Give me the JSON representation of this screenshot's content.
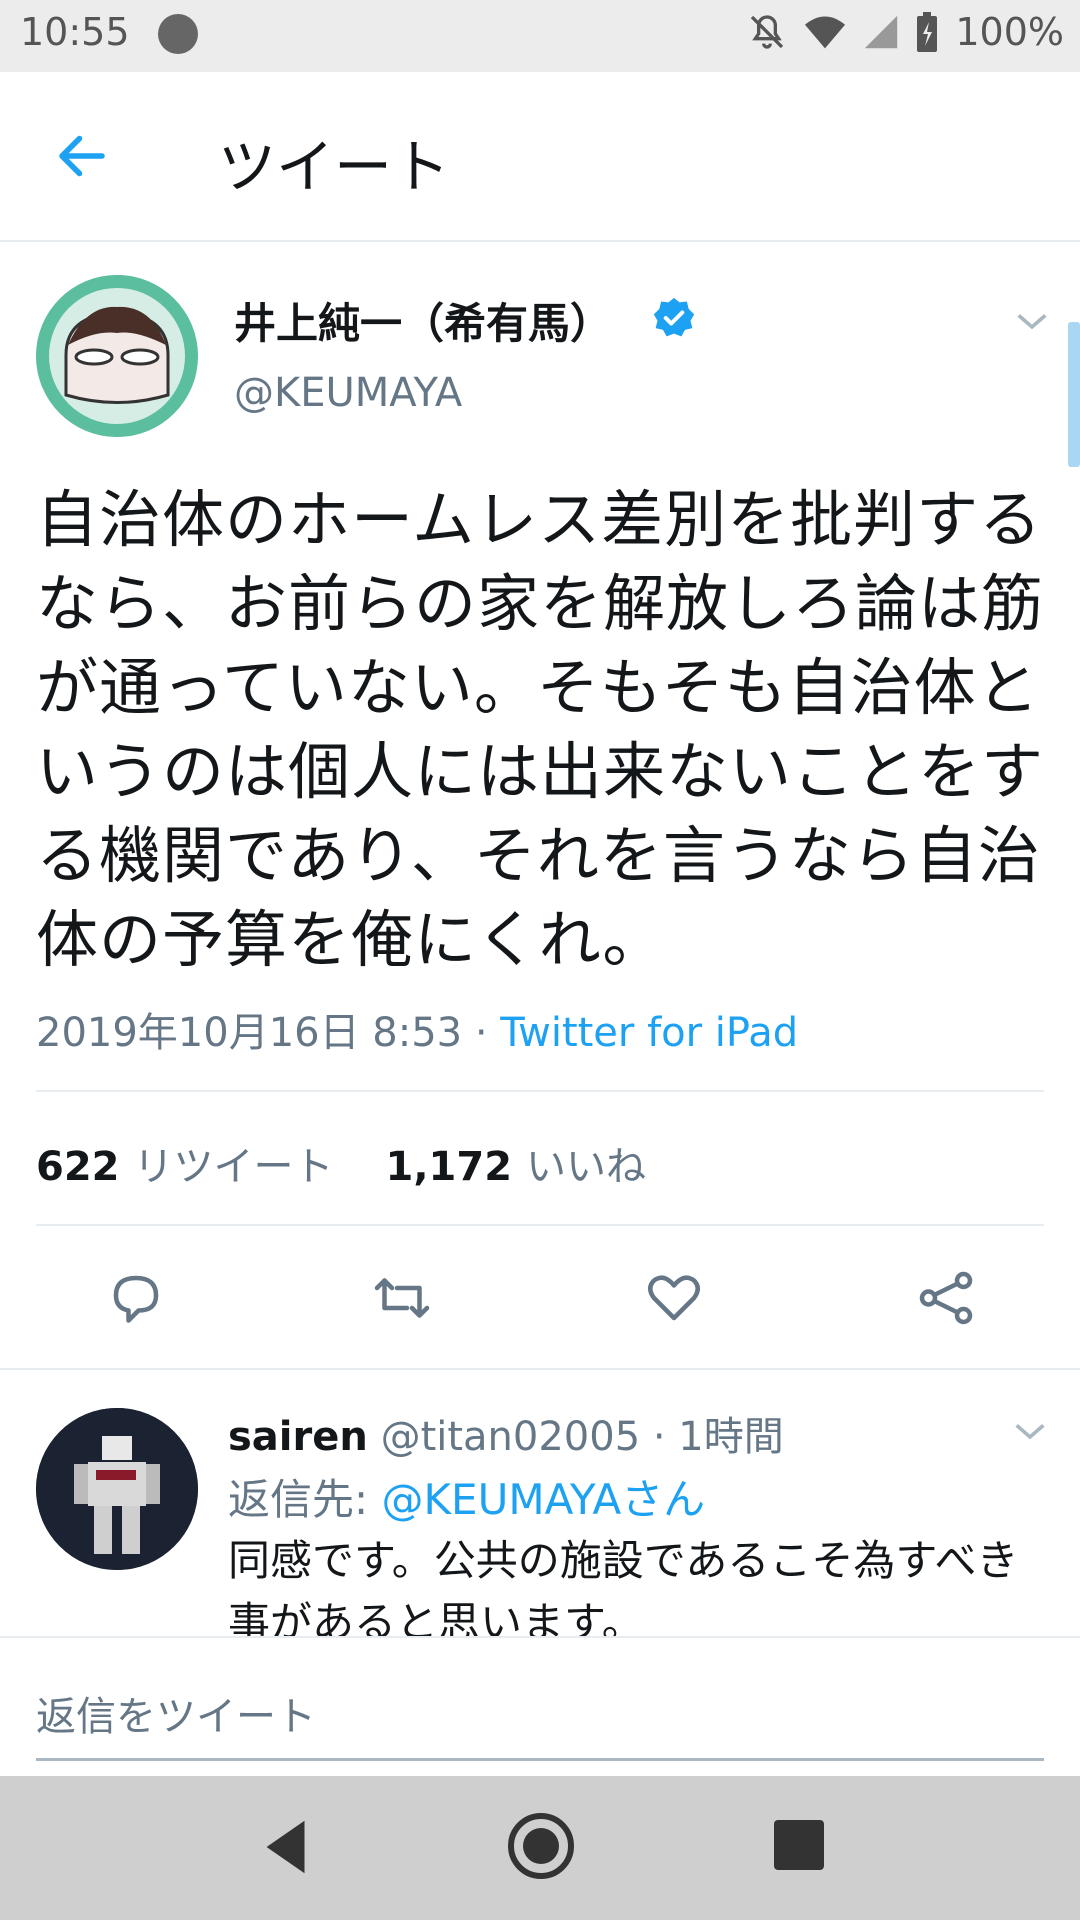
{
  "status_bar": {
    "time": "10:55",
    "battery": "100%",
    "icons": [
      "app-icon",
      "mute-icon",
      "wifi-icon",
      "signal-icon",
      "battery-icon"
    ]
  },
  "app_bar": {
    "title": "ツイート",
    "back_icon": "arrow-left-icon"
  },
  "tweet": {
    "author_name": "井上純一（希有馬）",
    "handle": "@KEUMAYA",
    "text": "自治体のホームレス差別を批判するなら、お前らの家を解放しろ論は筋が通っていない。そもそも自治体というのは個人には出来ないことをする機関であり、それを言うなら自治体の予算を俺にくれ。",
    "timestamp": "2019年10月16日 8:53",
    "separator": " · ",
    "source": "Twitter for iPad",
    "retweet_count": "622",
    "retweet_label": "リツイート",
    "like_count": "1,172",
    "like_label": "いいね",
    "actions": [
      "reply-icon",
      "retweet-icon",
      "like-icon",
      "share-icon"
    ]
  },
  "reply": {
    "name": "sairen",
    "handle": "@titan02005",
    "time": " · 1時間",
    "replying_to_label": "返信先: ",
    "replying_to_mention": "@KEUMAYAさん",
    "text": "同感です。公共の施設であるこそ為すべき事があると思います。"
  },
  "compose": {
    "placeholder": "返信をツイート"
  },
  "colors": {
    "accent": "#1da1f2",
    "secondary_text": "#657786",
    "primary_text": "#14171a",
    "divider": "#e6ecf0"
  }
}
